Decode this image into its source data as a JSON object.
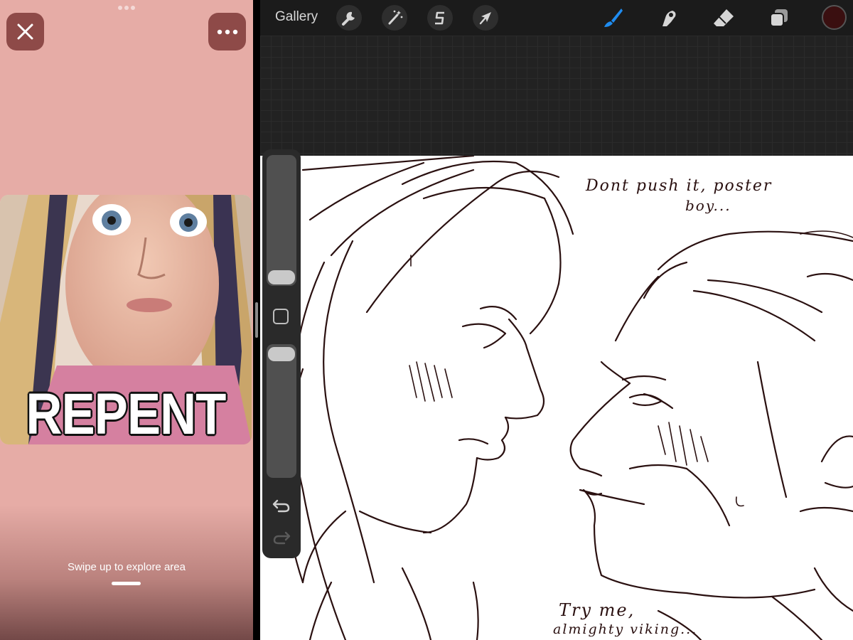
{
  "left_pane": {
    "close_icon": "close-icon",
    "more_icon": "more-horizontal-icon",
    "meme": {
      "caption": "REPENT"
    },
    "swipe_hint": "Swipe up to explore area"
  },
  "toolbar": {
    "gallery_label": "Gallery",
    "actions_icon": "wrench-icon",
    "adjustments_icon": "magic-wand-icon",
    "selection_icon": "selection-s-icon",
    "transform_icon": "arrow-cursor-icon",
    "brush_icon": "brush-icon",
    "smudge_icon": "smudge-icon",
    "eraser_icon": "eraser-icon",
    "layers_icon": "layers-icon",
    "active_color": "#3a0f10",
    "active_tool_color": "#1f8cf0"
  },
  "sidebar": {
    "undo_icon": "undo-icon",
    "redo_icon": "redo-icon"
  },
  "canvas": {
    "text_1": "Dont push it, poster",
    "text_2": "boy...",
    "text_3": "Try me,",
    "text_4": "almighty viking..."
  }
}
